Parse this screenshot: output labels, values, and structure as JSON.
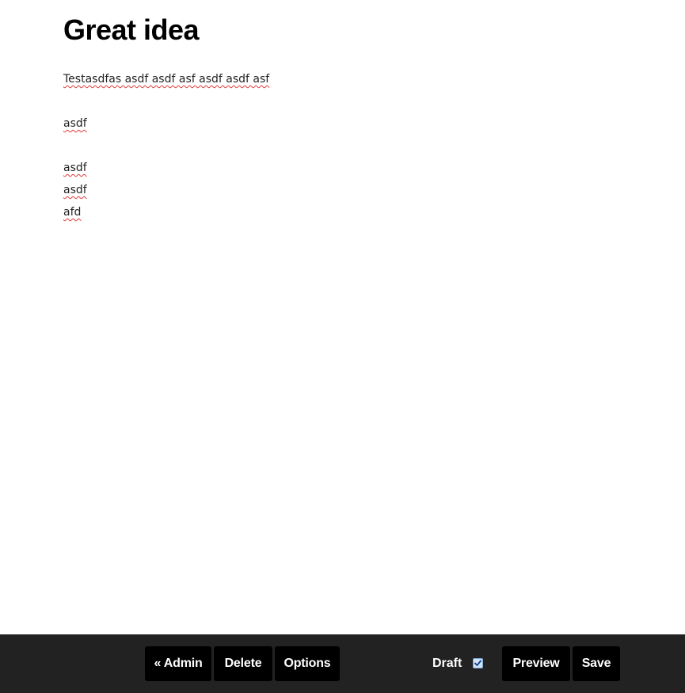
{
  "post": {
    "title": "Great idea",
    "lines": [
      "Testasdfas asdf asdf asf asdf asdf asf",
      "",
      "asdf",
      "",
      "asdf",
      "asdf",
      "afd"
    ]
  },
  "toolbar": {
    "admin_label": "« Admin",
    "delete_label": "Delete",
    "options_label": "Options",
    "draft_label": "Draft",
    "draft_checked": true,
    "preview_label": "Preview",
    "save_label": "Save"
  },
  "colors": {
    "toolbar_bg": "#222222",
    "button_bg": "#000000",
    "spellcheck_underline": "#e23a3a",
    "checkbox_fill": "#cfe3f7"
  },
  "icons": {
    "draft_checkbox": "checkmark-icon"
  }
}
